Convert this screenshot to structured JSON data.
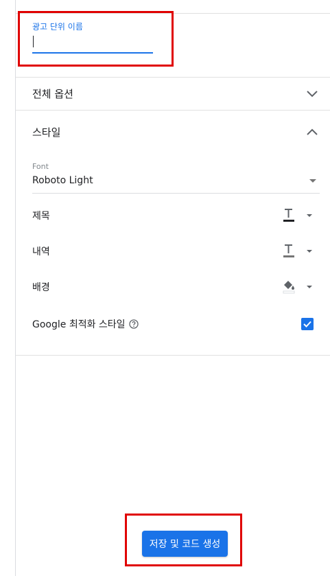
{
  "ad_unit_name": {
    "label": "광고 단위 이름",
    "value": "",
    "placeholder": ""
  },
  "sections": {
    "general_options": {
      "title": "전체 옵션",
      "expanded": false,
      "icon": "chevron-down-icon"
    },
    "style": {
      "title": "스타일",
      "expanded": true,
      "icon": "chevron-up-icon"
    }
  },
  "font": {
    "label": "Font",
    "value": "Roboto Light"
  },
  "style_rows": {
    "title": {
      "label": "제목",
      "icon": "text-color-icon",
      "color": "#202124"
    },
    "description": {
      "label": "내역",
      "icon": "text-color-icon",
      "color": "#757575"
    },
    "background": {
      "label": "배경",
      "icon": "fill-color-icon",
      "color": "#ffffff"
    }
  },
  "google_optimized": {
    "label": "Google 최적화 스타일",
    "help_icon": "help-icon",
    "checked": true
  },
  "actions": {
    "save_label": "저장 및 코드 생성"
  },
  "colors": {
    "accent": "#1a73e8",
    "highlight": "#e00000",
    "divider": "#e0e0e0"
  }
}
